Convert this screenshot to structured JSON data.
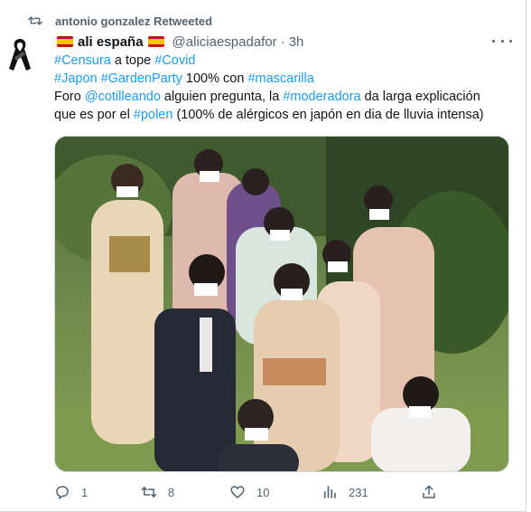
{
  "retweet": {
    "text": "antonio gonzalez Retweeted",
    "icon": "retweet-icon"
  },
  "author": {
    "name": "ali españa",
    "handle": "@aliciaespadafor",
    "separator": "·",
    "time": "3h",
    "flag_icon": "spain-flag-icon",
    "avatar_icon": "black-ribbon-icon"
  },
  "tweet": {
    "line1": {
      "tag1": "#Censura",
      "t1": " a tope ",
      "tag2": "#Covid"
    },
    "line2": {
      "tag1": "#Japon",
      "t1": " ",
      "tag2": "#GardenParty",
      "t2": " 100% con ",
      "tag3": "#mascarilla"
    },
    "line3": {
      "t1": "Foro ",
      "tag1": "@cotilleando",
      "t2": " alguien pregunta, la ",
      "tag2": "#moderadora",
      "t3": " da larga explicación"
    },
    "line4": {
      "t1": "que es por el ",
      "tag1": "#polen",
      "t2": " (100% de alérgicos en japón en dia de lluvia intensa)"
    }
  },
  "media": {
    "description_icon": "photo-image"
  },
  "actions": {
    "reply_count": "1",
    "retweet_count": "8",
    "like_count": "10",
    "views_count": "231"
  },
  "colors": {
    "link": "#1d9bf0",
    "secondary": "#536471",
    "border": "#cfd9de"
  }
}
